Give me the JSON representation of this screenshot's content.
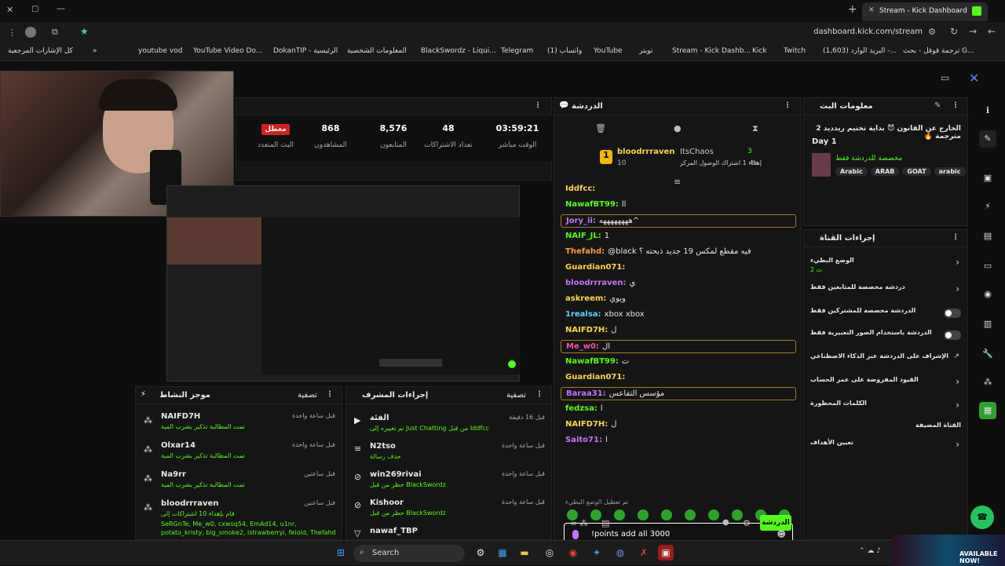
{
  "tab": {
    "title": "Stream - Kick Dashboard",
    "new_tab": "+",
    "close": "✕"
  },
  "window": {
    "min": "—",
    "max": "▢",
    "close": "✕"
  },
  "address": {
    "url": "dashboard.kick.com/stream"
  },
  "bookmarks": [
    "كل الإشارات المرجعية",
    "youtube vod",
    "YouTube Video Do...",
    "DokanTIP - الرئيسية",
    "المعلومات الشخصية",
    "BlackSwordz - Liqui...",
    "Telegram",
    "واتساب (1)",
    "YouTube",
    "تويتر",
    "Stream - Kick Dashb...",
    "Kick",
    "Twitch",
    "(1,603) البريد الوارد -...",
    "ترجمة قوقل - بحث G..."
  ],
  "stats": [
    {
      "value": "03:59:21",
      "label": "الوقت مباشر"
    },
    {
      "value": "48",
      "label": "تعداد الاشتراكات"
    },
    {
      "value": "8,576",
      "label": "المتابعون"
    },
    {
      "value": "868",
      "label": "المشاهدون"
    },
    {
      "value": "معطل",
      "label": "البث المتعدد"
    }
  ],
  "chat": {
    "title": "الدردشة",
    "pinned": {
      "user": "bloodrrraven",
      "count": "10",
      "rank": "1",
      "other": "ItsChaos",
      "other_count": "3",
      "note": "th",
      "gift": "إهداء 1 اشتراك الوصول المركز"
    },
    "messages": [
      {
        "user": "Iddfcc:",
        "text": "",
        "color": "#ffd54a"
      },
      {
        "user": "NawafBT99:",
        "text": "اا",
        "color": "#53fc18"
      },
      {
        "user": "Jory_ii:",
        "text": "ههههههههه^",
        "color": "#c673ff"
      },
      {
        "user": "NAIF_JL:",
        "text": "1",
        "color": "#53fc18"
      },
      {
        "user": "Thefahd:",
        "text": "@black فيه مقطع لمكس 19 جديد ذبحته ؟",
        "color": "#ff9a3c"
      },
      {
        "user": "Guardian071:",
        "text": "",
        "color": "#ffd54a"
      },
      {
        "user": "bloodrrraven:",
        "text": "ي",
        "color": "#c673ff"
      },
      {
        "user": "askreem:",
        "text": "ويوي",
        "color": "#ffd54a"
      },
      {
        "user": "1realsa:",
        "text": "xbox xbox",
        "color": "#5fd3ff"
      },
      {
        "user": "NAIFD7H:",
        "text": "ل",
        "color": "#ffd54a"
      },
      {
        "user": "Me_w0:",
        "text": "ال",
        "color": "#ff4fa3"
      },
      {
        "user": "NawafBT99:",
        "text": "ت",
        "color": "#53fc18"
      },
      {
        "user": "Guardian071:",
        "text": "",
        "color": "#ffd54a"
      },
      {
        "user": "Baraa31:",
        "text": "مؤسس التفاعس",
        "color": "#c673ff"
      },
      {
        "user": "fedzsa:",
        "text": "ا",
        "color": "#53fc18"
      },
      {
        "user": "NAIFD7H:",
        "text": "ل",
        "color": "#ffd54a"
      },
      {
        "user": "Saito71:",
        "text": "ا",
        "color": "#c673ff"
      }
    ],
    "system": "تم تعطيل الوضع البطيء",
    "input_value": "!points add all 3000",
    "send": "الدردشة"
  },
  "info": {
    "title": "معلومات البث",
    "stream_title": "الخارج عن القانون 😈 بداية تختيم ريدديد 2 مترجمة 🔥",
    "day": "Day 1",
    "category": "مخصصة للدردشة فقط",
    "tags": [
      "Arabic",
      "ARAB",
      "GOAT",
      "arabic"
    ]
  },
  "actions": {
    "title": "إجراءات القناة",
    "items": [
      {
        "label": "الوضع البطيء",
        "sub": "2 ث",
        "type": "chev"
      },
      {
        "label": "دردشة مخصصة للمتابعين فقط",
        "type": "chev"
      },
      {
        "label": "الدردشة مخصصة للمشتركين فقط",
        "type": "toggle"
      },
      {
        "label": "الدردشة باستخدام الصور التعبيرية فقط",
        "type": "toggle"
      },
      {
        "label": "الإشراف على الدردشة عبر الذكاء الاصطناعي",
        "type": "ext"
      },
      {
        "label": "القيود المفروضة على عمر الحساب",
        "type": "chev"
      },
      {
        "label": "الكلمات المحظورة",
        "type": "chev"
      },
      {
        "label": "القناة المضيفة",
        "type": "none"
      },
      {
        "label": "تعيين الأهداف",
        "type": "chev"
      }
    ]
  },
  "activity": {
    "title": "موجز النشاط",
    "filter": "تصفية",
    "items": [
      {
        "user": "NAIFD7H",
        "time": "قبل ساعة واحدة",
        "desc": "تمت المطالبة تذكير بشرب المية"
      },
      {
        "user": "Olxar14",
        "time": "قبل ساعة واحدة",
        "desc": "تمت المطالبة تذكير بشرب المية"
      },
      {
        "user": "Na9rr",
        "time": "قبل ساعتين",
        "desc": "تمت المطالبة تذكير بشرب المية"
      },
      {
        "user": "bloodrrraven",
        "time": "قبل ساعتين",
        "desc": "قام بإهداء 10 اشتراكات إلى",
        "extra": "SeRGnTe, Me_w0, cxwsq54, EmAd14, u1nr, potato_kristy, big_smoke2, istrawberryi, feiold, Thefahd"
      }
    ]
  },
  "modactions": {
    "title": "إجراءات المشرف",
    "filter": "تصفية",
    "items": [
      {
        "user": "الفئة",
        "time": "قبل 16 دقيقة",
        "desc": "تم تغييره إلى Just Chatting من قبل Iddfcc"
      },
      {
        "user": "N2tso",
        "time": "قبل ساعة واحدة",
        "desc": "حذف رسالة"
      },
      {
        "user": "win269rivai",
        "time": "قبل ساعة واحدة",
        "desc": "حظر من قبل BlackSwordz"
      },
      {
        "user": "Kishoor",
        "time": "قبل ساعة واحدة",
        "desc": "حظر من قبل BlackSwordz"
      },
      {
        "user": "nawaf_TBP",
        "time": "",
        "desc": ""
      }
    ]
  },
  "taskbar": {
    "search": "Search",
    "time": "",
    "ad": "AVAILABLE NOW!"
  },
  "colors": {
    "accent": "#53fc18",
    "bg": "#0e0e0e",
    "panel": "#151515"
  }
}
